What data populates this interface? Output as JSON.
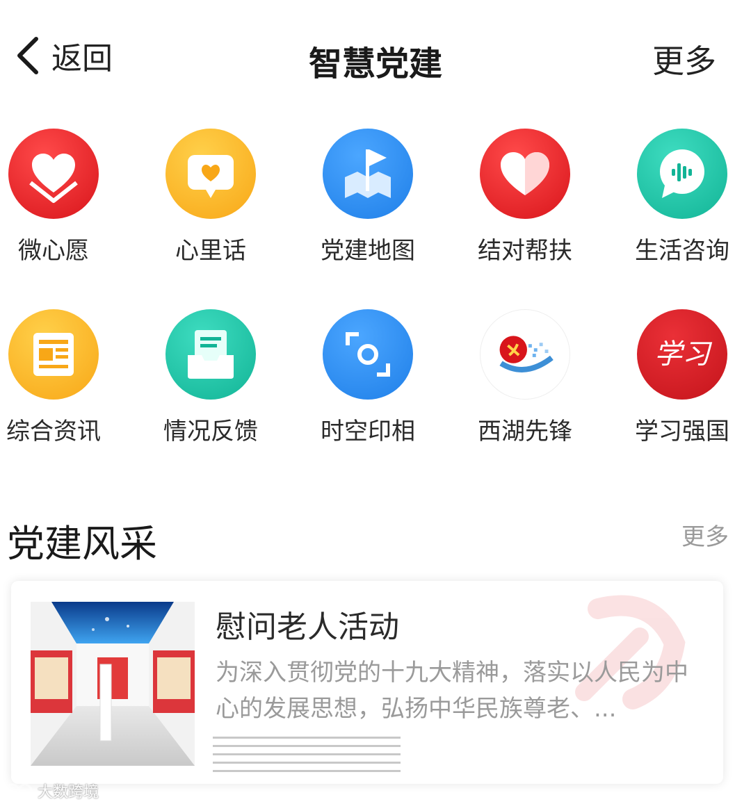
{
  "header": {
    "back_label": "返回",
    "title": "智慧党建",
    "more_label": "更多"
  },
  "grid": {
    "rows": [
      [
        {
          "label": "微心愿",
          "icon": "heart-book-icon",
          "color": "#e3262a"
        },
        {
          "label": "心里话",
          "icon": "heart-message-icon",
          "color": "#fbb321"
        },
        {
          "label": "党建地图",
          "icon": "map-flag-icon",
          "color": "#2f8df0"
        },
        {
          "label": "结对帮扶",
          "icon": "double-heart-icon",
          "color": "#e3262a"
        },
        {
          "label": "生活咨询",
          "icon": "voice-chat-icon",
          "color": "#1fc4a8"
        }
      ],
      [
        {
          "label": "综合资讯",
          "icon": "newspaper-icon",
          "color": "#fbb321"
        },
        {
          "label": "情况反馈",
          "icon": "feedback-tray-icon",
          "color": "#1fc4a8"
        },
        {
          "label": "时空印相",
          "icon": "scan-camera-icon",
          "color": "#2f8df0"
        },
        {
          "label": "西湖先锋",
          "icon": "party-emblem-icon",
          "color": "#ffffff"
        },
        {
          "label": "学习强国",
          "icon": "xuexi-icon",
          "color": "#d11f26"
        }
      ]
    ]
  },
  "section": {
    "title": "党建风采",
    "more_label": "更多"
  },
  "card": {
    "title": "慰问老人活动",
    "description": "为深入贯彻党的十九大精神，落实以人民为中心的发展思想，弘扬中华民族尊老、..."
  },
  "watermark": {
    "text": "大数跨境"
  }
}
